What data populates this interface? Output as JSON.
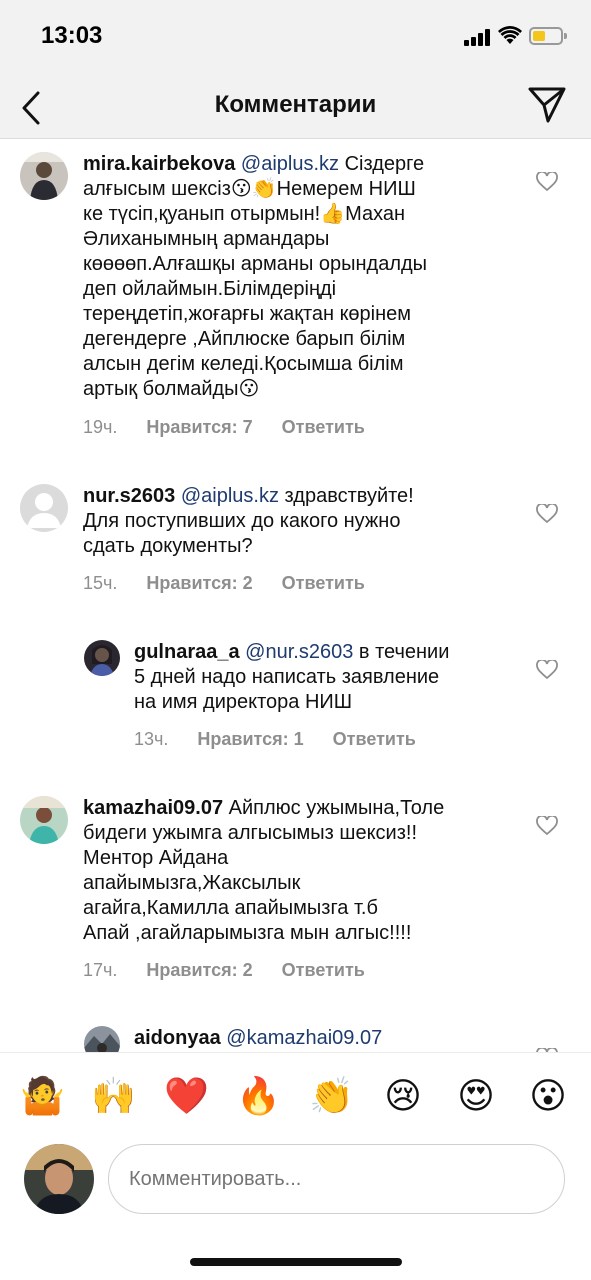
{
  "status": {
    "time": "13:03",
    "battery_color": "#f4c51a"
  },
  "header": {
    "title": "Комментарии",
    "back_icon": "chevron-left-icon",
    "send_icon": "paper-plane-icon"
  },
  "comments": [
    {
      "user": "mira.kairbekova",
      "mention": "@aiplus.kz",
      "lines": [
        "Сіздерге",
        "алғысым шексіз😗👏Немерем НИШ",
        "ке түсіп,қуанып отырмын!👍Махан",
        "Әлиханымның армандары",
        "көөөөп.Алғашқы арманы орындалды",
        "деп ойлаймын.Білімдеріңді",
        "тереңдетіп,жоғарғы жақтан көрінем",
        "дегендерге ,Айплюске барып білім",
        "алсын дегім келеді.Қосымша білім",
        "артық болмайды😗"
      ],
      "time": "19ч.",
      "likes": "Нравится: 7",
      "reply": "Ответить"
    },
    {
      "user": "nur.s2603",
      "mention": "@aiplus.kz",
      "lines": [
        "здравствуйте!",
        "Для поступивших до какого нужно",
        "сдать документы?"
      ],
      "time": "15ч.",
      "likes": "Нравится: 2",
      "reply": "Ответить"
    },
    {
      "user": "gulnaraa_a",
      "mention": "@nur.s2603",
      "lines": [
        "в течении",
        "5 дней надо написать заявление",
        "на имя директора НИШ"
      ],
      "time": "13ч.",
      "likes": "Нравится: 1",
      "reply": "Ответить"
    },
    {
      "user": "kamazhai09.07",
      "mention": "",
      "lines": [
        "Айплюс ужымына,Толе",
        "бидеги ужымга алгысымыз шексиз!!",
        "Ментор Айдана",
        "апайымызга,Жаксылык",
        "агайга,Камилла апайымызга т.б",
        "Апай ,агайларымызга мын алгыс!!!!"
      ],
      "time": "17ч.",
      "likes": "Нравится: 2",
      "reply": "Ответить"
    },
    {
      "user": "aidonyaa",
      "mention": "@kamazhai09.07",
      "lines": [],
      "time": "",
      "likes": "",
      "reply": ""
    }
  ],
  "emoji_bar": [
    "🤷",
    "🙌",
    "❤️",
    "🔥",
    "👏",
    "😢",
    "😍",
    "😮"
  ],
  "composer": {
    "placeholder": "Комментировать..."
  }
}
